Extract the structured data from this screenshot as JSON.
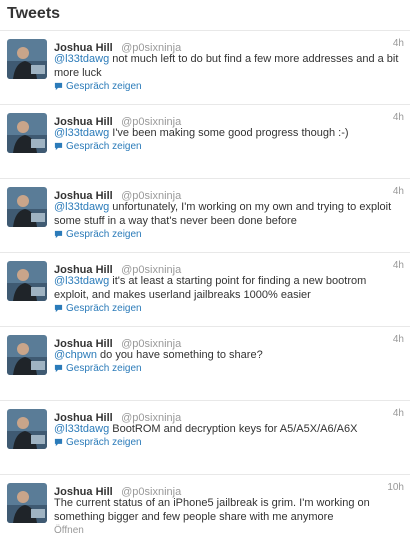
{
  "header": {
    "title": "Tweets"
  },
  "tweets": [
    {
      "name": "Joshua Hill",
      "handle": "@p0sixninja",
      "time": "4h",
      "mention": "@l33tdawg",
      "text": " not much left to do but find a few more addresses and a bit more luck",
      "action": "Gespräch zeigen"
    },
    {
      "name": "Joshua Hill",
      "handle": "@p0sixninja",
      "time": "4h",
      "mention": "@l33tdawg",
      "text": " I've been making some good progress though :-)",
      "action": "Gespräch zeigen"
    },
    {
      "name": "Joshua Hill",
      "handle": "@p0sixninja",
      "time": "4h",
      "mention": "@l33tdawg",
      "text": " unfortunately, I'm working on my own and trying to exploit some stuff in a way that's never been done before",
      "action": "Gespräch zeigen"
    },
    {
      "name": "Joshua Hill",
      "handle": "@p0sixninja",
      "time": "4h",
      "mention": "@l33tdawg",
      "text": " it's at least a starting point for finding a new bootrom exploit, and makes userland jailbreaks 1000% easier",
      "action": "Gespräch zeigen"
    },
    {
      "name": "Joshua Hill",
      "handle": "@p0sixninja",
      "time": "4h",
      "mention": "@chpwn",
      "text": " do you have something to share?",
      "action": "Gespräch zeigen"
    },
    {
      "name": "Joshua Hill",
      "handle": "@p0sixninja",
      "time": "4h",
      "mention": "@l33tdawg",
      "text": " BootROM and decryption keys for A5/A5X/A6/A6X",
      "action": "Gespräch zeigen"
    },
    {
      "name": "Joshua Hill",
      "handle": "@p0sixninja",
      "time": "10h",
      "mention": "",
      "text": "The current status of an iPhone5 jailbreak is grim. I'm working on something bigger and few people share with me anymore",
      "action": "Öffnen"
    }
  ],
  "icons": {
    "conversation": "speech-bubble-icon"
  },
  "colors": {
    "link": "#2b7bb9",
    "muted": "#999999",
    "text": "#333333",
    "divider": "#e8e8e8"
  }
}
